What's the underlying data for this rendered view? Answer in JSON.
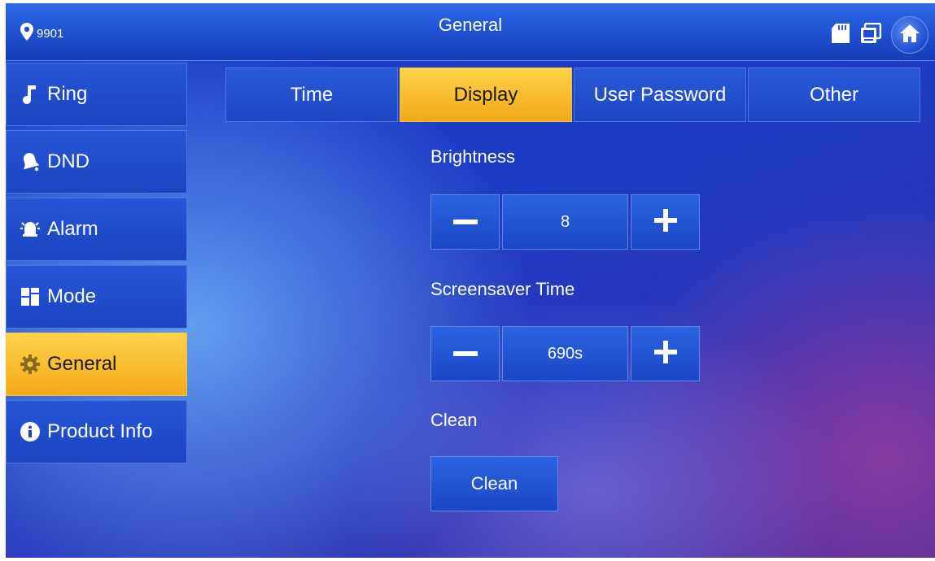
{
  "header": {
    "location": "9901",
    "title": "General"
  },
  "sidebar": {
    "items": [
      {
        "label": "Ring",
        "icon": "music-note-icon"
      },
      {
        "label": "DND",
        "icon": "bell-icon"
      },
      {
        "label": "Alarm",
        "icon": "alarm-icon"
      },
      {
        "label": "Mode",
        "icon": "mode-grid-icon"
      },
      {
        "label": "General",
        "icon": "gear-icon",
        "active": true
      },
      {
        "label": "Product Info",
        "icon": "info-icon"
      }
    ]
  },
  "tabs": [
    {
      "label": "Time"
    },
    {
      "label": "Display",
      "active": true
    },
    {
      "label": "User Password"
    },
    {
      "label": "Other"
    }
  ],
  "display": {
    "brightness_label": "Brightness",
    "brightness_value": "8",
    "screensaver_label": "Screensaver Time",
    "screensaver_value": "690s",
    "clean_label": "Clean",
    "clean_button": "Clean"
  },
  "colors": {
    "accent": "#f2a818",
    "primary": "#1d47c4"
  }
}
